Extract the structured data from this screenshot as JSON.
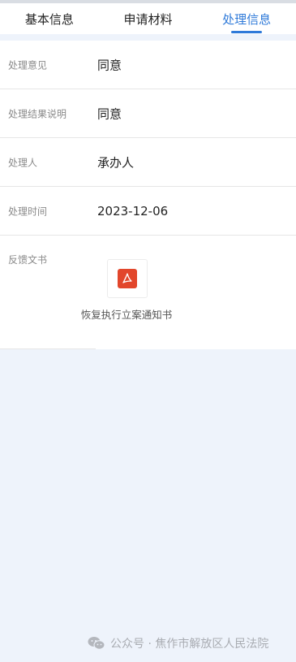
{
  "tabs": [
    {
      "label": "基本信息"
    },
    {
      "label": "申请材料"
    },
    {
      "label": "处理信息"
    }
  ],
  "details": [
    {
      "label": "处理意见",
      "value": "同意"
    },
    {
      "label": "处理结果说明",
      "value": "同意"
    },
    {
      "label": "处理人",
      "value": "承办人"
    },
    {
      "label": "处理时间",
      "value": "2023-12-06"
    }
  ],
  "feedback": {
    "label": "反馈文书",
    "file_icon": "pdf-icon",
    "file_name": "恢复执行立案通知书"
  },
  "watermark": {
    "icon": "wechat-icon",
    "text": "公众号 · 焦作市解放区人民法院"
  },
  "colors": {
    "accent": "#2f7ad9",
    "pdf": "#e2462b",
    "page_background": "#eef3fb"
  }
}
